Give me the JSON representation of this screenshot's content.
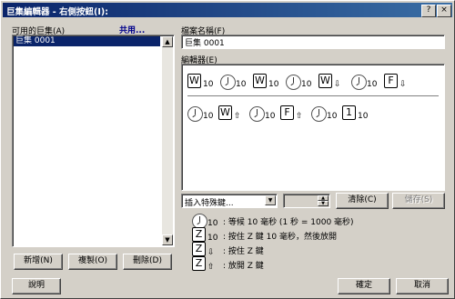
{
  "window": {
    "title": "巨集編輯器 - 右側按鈕(I):",
    "help_glyph": "?",
    "close_glyph": "×"
  },
  "available": {
    "label": "可用的巨集(A)",
    "shared_link": "共用...",
    "items": [
      "巨集 0001"
    ]
  },
  "left_buttons": {
    "new": "新增(N)",
    "copy": "複製(O)",
    "delete": "刪除(D)"
  },
  "filename": {
    "label": "檔案名稱(F)",
    "value": "巨集 0001"
  },
  "editor": {
    "label": "編輯器(E)",
    "row1": [
      {
        "type": "key",
        "char": "W",
        "sub": "10"
      },
      {
        "type": "clock",
        "sub": "10"
      },
      {
        "type": "key",
        "char": "W",
        "sub": "10"
      },
      {
        "type": "clock",
        "sub": "10"
      },
      {
        "type": "key",
        "char": "W",
        "sub": "⇩"
      },
      {
        "type": "clock",
        "sub": "10"
      },
      {
        "type": "key",
        "char": "F",
        "sub": "⇩"
      }
    ],
    "row2": [
      {
        "type": "clock",
        "sub": "10"
      },
      {
        "type": "key",
        "char": "W",
        "sub": "⇧"
      },
      {
        "type": "clock",
        "sub": "10"
      },
      {
        "type": "key",
        "char": "F",
        "sub": "⇧"
      },
      {
        "type": "clock",
        "sub": "10"
      },
      {
        "type": "key",
        "char": "1",
        "sub": "10"
      }
    ]
  },
  "controls": {
    "insert_special": "插入特殊鍵...",
    "clear": "清除(C)",
    "save": "儲存(S)"
  },
  "legend": [
    {
      "icon": "clock",
      "sub": "10",
      "text": ": 等候 10 毫秒 (1 秒 = 1000 毫秒)"
    },
    {
      "icon": "key",
      "char": "Z",
      "sub": "10",
      "text": ": 按住 Z 鍵 10 毫秒，然後放開"
    },
    {
      "icon": "key",
      "char": "Z",
      "sub": "⇩",
      "text": ": 按住 Z 鍵"
    },
    {
      "icon": "key",
      "char": "Z",
      "sub": "⇧",
      "text": ": 放開 Z 鍵"
    }
  ],
  "bottom_buttons": {
    "help": "說明",
    "ok": "確定",
    "cancel": "取消"
  }
}
